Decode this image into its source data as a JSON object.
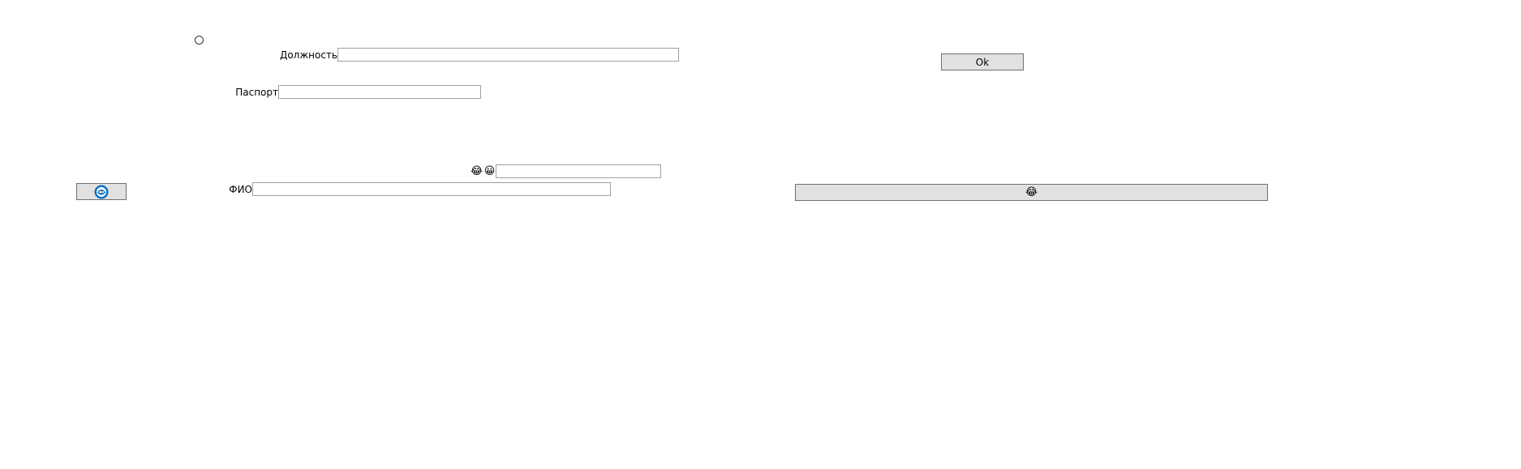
{
  "form": {
    "radio_selected": false,
    "position_label": "Должность",
    "position_value": "",
    "passport_label": "Паспорт",
    "passport_value": "",
    "fio_label": "ФИО",
    "fio_value": "",
    "extra_value": "",
    "emoji_1": "😂",
    "emoji_2": "😀"
  },
  "buttons": {
    "ok_label": "Ok",
    "logo_icon": "blue-round-logo-icon",
    "wide_button_emoji": "😂"
  },
  "colors": {
    "button_bg": "#e1e1e1",
    "button_border": "#707070",
    "field_border": "#a0a0a0",
    "logo_blue": "#0a6fc2"
  }
}
